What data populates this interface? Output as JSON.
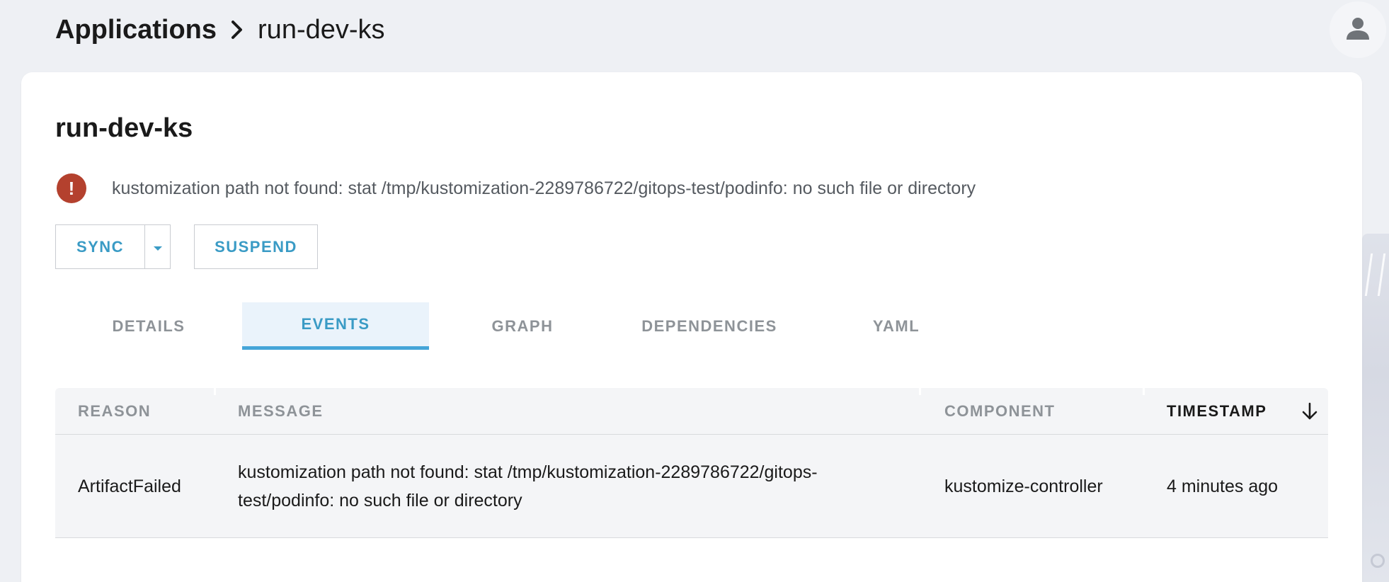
{
  "breadcrumb": {
    "root": "Applications",
    "current": "run-dev-ks"
  },
  "icons": {
    "separator": "chevron-right-icon",
    "avatar": "user-icon",
    "alert": "error-icon",
    "sort": "arrow-down-icon"
  },
  "colors": {
    "accent": "#3a9bc5",
    "tab_underline": "#45a5d8",
    "error": "#b4412e",
    "page_bg": "#eef0f4"
  },
  "page": {
    "title": "run-dev-ks",
    "alert_message": "kustomization path not found: stat /tmp/kustomization-2289786722/gitops-test/podinfo: no such file or directory"
  },
  "actions": {
    "sync_label": "SYNC",
    "suspend_label": "SUSPEND"
  },
  "tabs": [
    {
      "label": "DETAILS",
      "active": false
    },
    {
      "label": "EVENTS",
      "active": true
    },
    {
      "label": "GRAPH",
      "active": false
    },
    {
      "label": "DEPENDENCIES",
      "active": false
    },
    {
      "label": "YAML",
      "active": false
    }
  ],
  "events_table": {
    "columns": [
      "REASON",
      "MESSAGE",
      "COMPONENT",
      "TIMESTAMP"
    ],
    "sorted_by": "TIMESTAMP",
    "sort_direction": "descending",
    "rows": [
      {
        "reason": "ArtifactFailed",
        "message": "kustomization path not found: stat /tmp/kustomization-2289786722/gitops-test/podinfo: no such file or directory",
        "component": "kustomize-controller",
        "timestamp": "4 minutes ago"
      }
    ]
  }
}
